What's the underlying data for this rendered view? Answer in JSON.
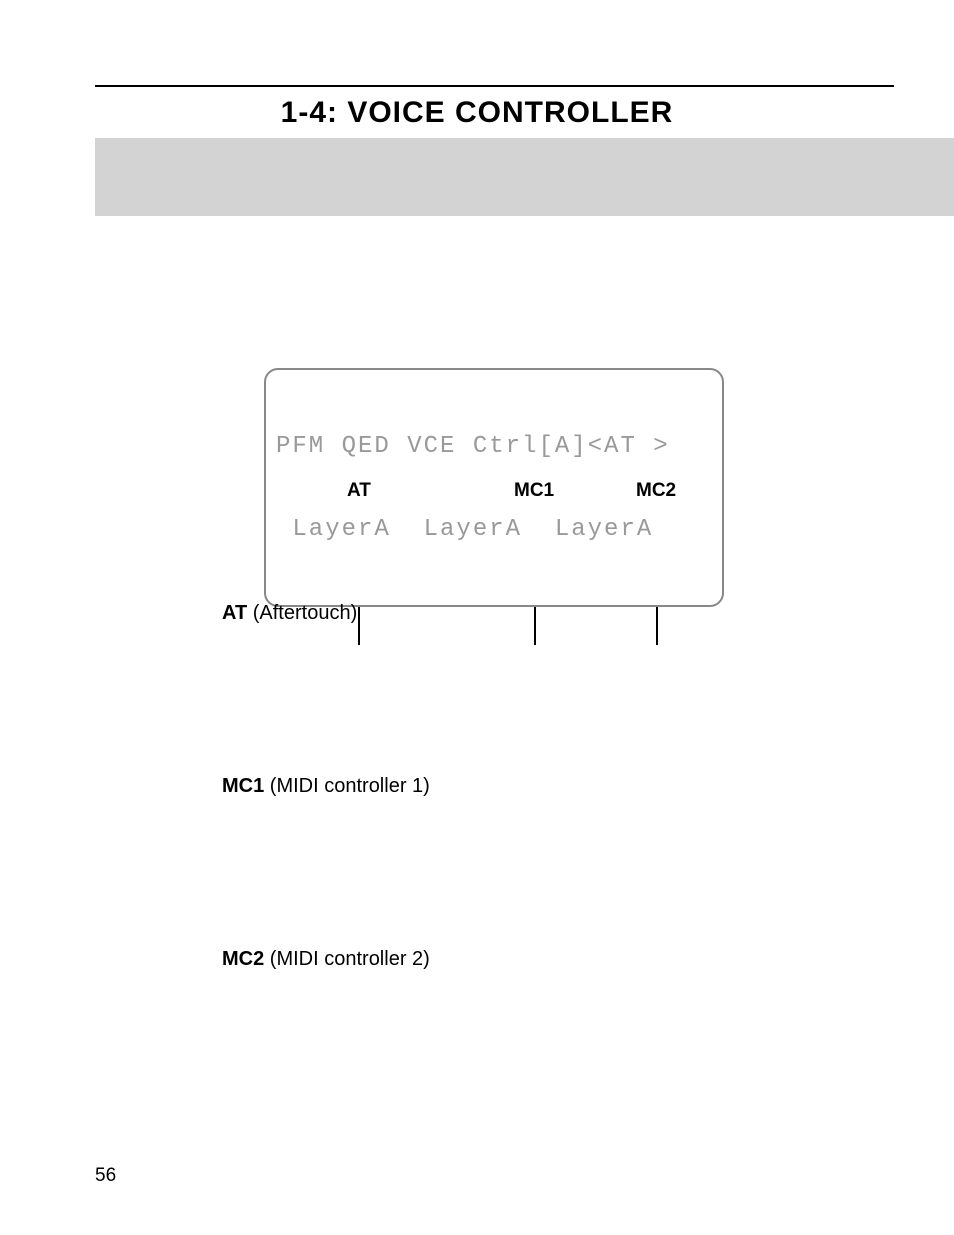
{
  "title": "1-4: VOICE CONTROLLER",
  "lcd": {
    "line1": "PFM QED VCE Ctrl[A]<AT >",
    "line2": " LayerA  LayerA  LayerA"
  },
  "callouts": {
    "at": "AT",
    "mc1": "MC1",
    "mc2": "MC2"
  },
  "params": {
    "at": {
      "abbr": "AT",
      "name": " (Aftertouch)"
    },
    "mc1": {
      "abbr": "MC1",
      "name": " (MIDI controller 1)"
    },
    "mc2": {
      "abbr": "MC2",
      "name": " (MIDI controller 2)"
    }
  },
  "pageNumber": "56"
}
